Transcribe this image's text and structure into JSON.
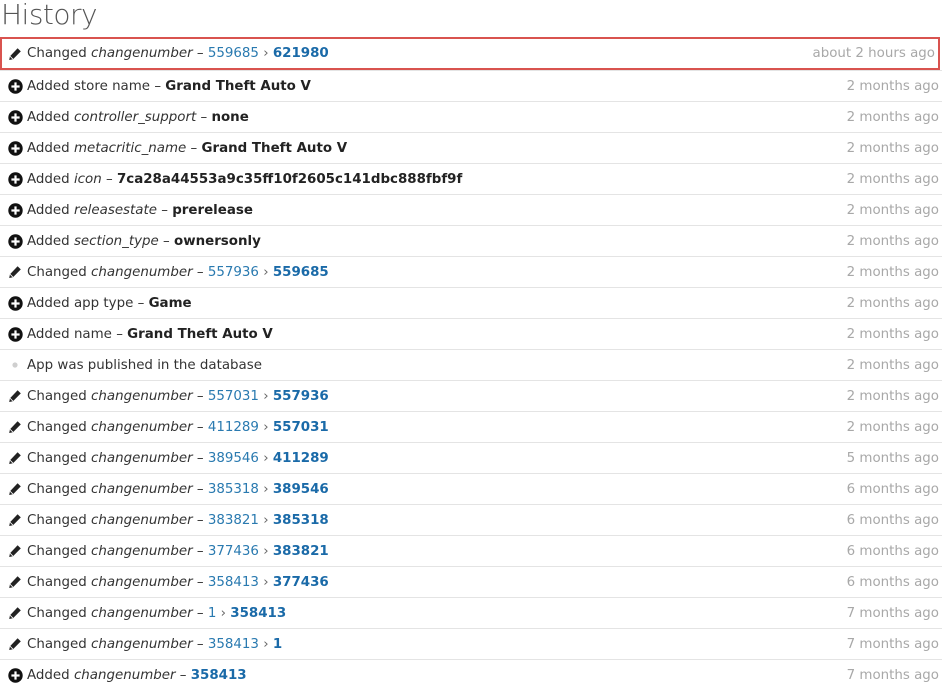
{
  "page_title": "History",
  "entries": [
    {
      "icon": "pencil-icon",
      "action": "Changed",
      "field": "changenumber",
      "field_italic": true,
      "old": "559685",
      "new": "621980",
      "time": "about 2 hours ago",
      "highlight": true
    },
    {
      "icon": "plus-circle-icon",
      "action": "Added",
      "field": "store name",
      "field_italic": false,
      "value": "Grand Theft Auto V",
      "time": "2 months ago"
    },
    {
      "icon": "plus-circle-icon",
      "action": "Added",
      "field": "controller_support",
      "field_italic": true,
      "value": "none",
      "time": "2 months ago"
    },
    {
      "icon": "plus-circle-icon",
      "action": "Added",
      "field": "metacritic_name",
      "field_italic": true,
      "value": "Grand Theft Auto V",
      "time": "2 months ago"
    },
    {
      "icon": "plus-circle-icon",
      "action": "Added",
      "field": "icon",
      "field_italic": true,
      "value": "7ca28a44553a9c35ff10f2605c141dbc888fbf9f",
      "time": "2 months ago"
    },
    {
      "icon": "plus-circle-icon",
      "action": "Added",
      "field": "releasestate",
      "field_italic": true,
      "value": "prerelease",
      "time": "2 months ago"
    },
    {
      "icon": "plus-circle-icon",
      "action": "Added",
      "field": "section_type",
      "field_italic": true,
      "value": "ownersonly",
      "time": "2 months ago"
    },
    {
      "icon": "pencil-icon",
      "action": "Changed",
      "field": "changenumber",
      "field_italic": true,
      "old": "557936",
      "new": "559685",
      "time": "2 months ago"
    },
    {
      "icon": "plus-circle-icon",
      "action": "Added",
      "field": "app type",
      "field_italic": false,
      "value": "Game",
      "time": "2 months ago"
    },
    {
      "icon": "plus-circle-icon",
      "action": "Added",
      "field": "name",
      "field_italic": false,
      "value": "Grand Theft Auto V",
      "time": "2 months ago"
    },
    {
      "icon": "dot-icon",
      "text": "App was published in the database",
      "time": "2 months ago"
    },
    {
      "icon": "pencil-icon",
      "action": "Changed",
      "field": "changenumber",
      "field_italic": true,
      "old": "557031",
      "new": "557936",
      "time": "2 months ago"
    },
    {
      "icon": "pencil-icon",
      "action": "Changed",
      "field": "changenumber",
      "field_italic": true,
      "old": "411289",
      "new": "557031",
      "time": "2 months ago"
    },
    {
      "icon": "pencil-icon",
      "action": "Changed",
      "field": "changenumber",
      "field_italic": true,
      "old": "389546",
      "new": "411289",
      "time": "5 months ago"
    },
    {
      "icon": "pencil-icon",
      "action": "Changed",
      "field": "changenumber",
      "field_italic": true,
      "old": "385318",
      "new": "389546",
      "time": "6 months ago"
    },
    {
      "icon": "pencil-icon",
      "action": "Changed",
      "field": "changenumber",
      "field_italic": true,
      "old": "383821",
      "new": "385318",
      "time": "6 months ago"
    },
    {
      "icon": "pencil-icon",
      "action": "Changed",
      "field": "changenumber",
      "field_italic": true,
      "old": "377436",
      "new": "383821",
      "time": "6 months ago"
    },
    {
      "icon": "pencil-icon",
      "action": "Changed",
      "field": "changenumber",
      "field_italic": true,
      "old": "358413",
      "new": "377436",
      "time": "6 months ago"
    },
    {
      "icon": "pencil-icon",
      "action": "Changed",
      "field": "changenumber",
      "field_italic": true,
      "old": "1",
      "new": "358413",
      "time": "7 months ago"
    },
    {
      "icon": "pencil-icon",
      "action": "Changed",
      "field": "changenumber",
      "field_italic": true,
      "old": "358413",
      "new": "1",
      "time": "7 months ago"
    },
    {
      "icon": "plus-circle-icon",
      "action": "Added",
      "field": "changenumber",
      "field_italic": true,
      "value": "358413",
      "value_link": true,
      "time": "7 months ago"
    }
  ],
  "separators": {
    "dash": "–",
    "arrow": "›"
  }
}
